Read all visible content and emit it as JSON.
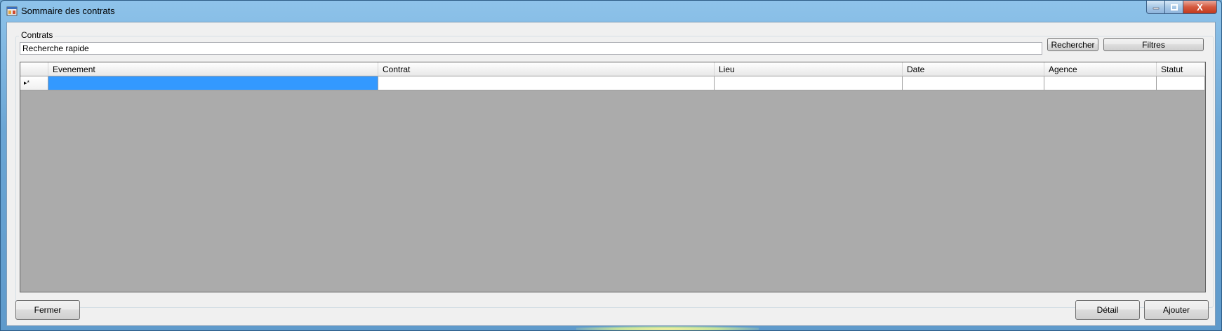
{
  "window": {
    "title": "Sommaire des contrats",
    "controls": {
      "minimize_icon": "minimize-icon",
      "maximize_icon": "maximize-icon",
      "close_icon": "close-icon",
      "close_glyph": "X"
    }
  },
  "group": {
    "label": "Contrats"
  },
  "search": {
    "value": "Recherche rapide",
    "search_button": "Rechercher",
    "filters_button": "Filtres"
  },
  "grid": {
    "row_indicator": "▸*",
    "columns": [
      "Evenement",
      "Contrat",
      "Lieu",
      "Date",
      "Agence",
      "Statut"
    ],
    "rows": [
      [
        "",
        "",
        "",
        "",
        "",
        ""
      ]
    ],
    "selection_color": "#3399ff",
    "background_color": "#ababab"
  },
  "footer": {
    "close_button": "Fermer",
    "detail_button": "Détail",
    "add_button": "Ajouter"
  }
}
